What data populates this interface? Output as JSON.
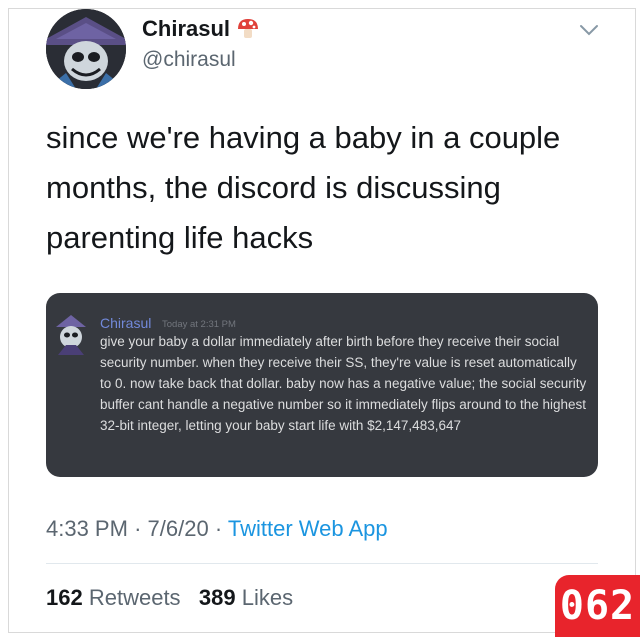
{
  "tweet": {
    "author": {
      "display_name": "Chirasul",
      "handle": "@chirasul",
      "badge_icon": "mushroom-icon"
    },
    "text": "since we're having a baby in a couple months, the discord is discussing parenting life hacks",
    "embedded_discord": {
      "username": "Chirasul",
      "timestamp": "Today at 2:31 PM",
      "message": "give your baby a dollar immediately after birth before they receive their social security number. when they receive their SS, they're value is reset automatically to 0. now take back that dollar. baby now has a negative value; the social security buffer cant handle a negative number so it immediately flips around to the highest 32-bit integer, letting your baby start life with $2,147,483,647",
      "colors": {
        "background": "#36393f",
        "username": "#7289da",
        "text": "#dcddde"
      }
    },
    "time": "4:33 PM",
    "date": "7/6/20",
    "separator": "·",
    "source": "Twitter Web App",
    "retweets_count": "162",
    "retweets_label": "Retweets",
    "likes_count": "389",
    "likes_label": "Likes"
  },
  "overlay_badge": "062",
  "colors": {
    "link": "#1b95e0",
    "muted": "#5b6670",
    "badge": "#e8242c"
  }
}
